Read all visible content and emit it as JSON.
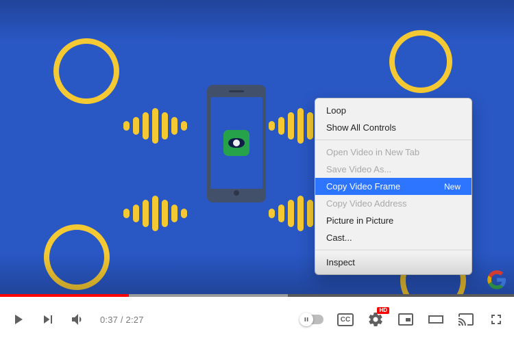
{
  "player": {
    "current_time": "0:37",
    "duration": "2:27",
    "buffered_percent": 56,
    "played_percent": 25,
    "hd_badge": "HD",
    "cc_label": "CC"
  },
  "context_menu": {
    "items": [
      {
        "label": "Loop",
        "disabled": false
      },
      {
        "label": "Show All Controls",
        "disabled": false
      }
    ],
    "group2": [
      {
        "label": "Open Video in New Tab",
        "disabled": true
      },
      {
        "label": "Save Video As...",
        "disabled": true
      },
      {
        "label": "Copy Video Frame",
        "tag": "New",
        "disabled": false,
        "selected": true
      },
      {
        "label": "Copy Video Address",
        "disabled": true
      },
      {
        "label": "Picture in Picture",
        "disabled": false
      },
      {
        "label": "Cast...",
        "disabled": false
      }
    ],
    "group3": [
      {
        "label": "Inspect",
        "disabled": false
      }
    ]
  }
}
